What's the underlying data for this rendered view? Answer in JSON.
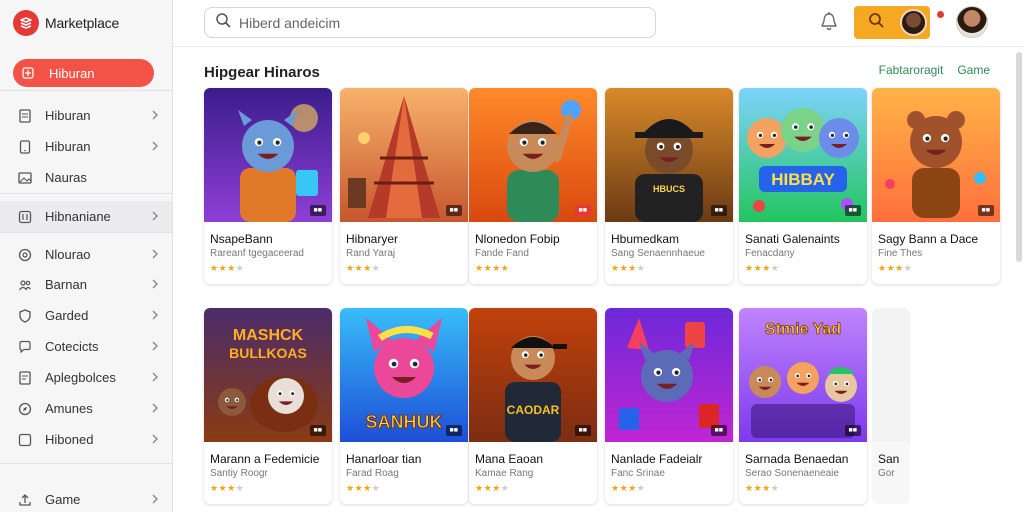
{
  "brand": {
    "name": "Marketplace",
    "icon": "layers-logo-icon"
  },
  "sidebar": {
    "active": {
      "label": "Hiburan",
      "icon": "play-grid-icon"
    },
    "items": [
      {
        "label": "Hiburan",
        "icon": "document-icon"
      },
      {
        "label": "Hiburan",
        "icon": "tablet-icon"
      },
      {
        "label": "Nauras",
        "icon": "image-icon"
      },
      {
        "label": "Hibnaniane",
        "icon": "sliders-icon"
      },
      {
        "label": "Nlourao",
        "icon": "target-icon"
      },
      {
        "label": "Barnan",
        "icon": "people-icon"
      },
      {
        "label": "Garded",
        "icon": "shield-icon"
      },
      {
        "label": "Cotecicts",
        "icon": "chat-icon"
      },
      {
        "label": "Aplegbolces",
        "icon": "doc-edit-icon"
      },
      {
        "label": "Amunes",
        "icon": "compass-icon"
      },
      {
        "label": "Hiboned",
        "icon": "square-icon"
      },
      {
        "label": "Game",
        "icon": "upload-icon"
      }
    ]
  },
  "topbar": {
    "search_placeholder": "Hiberd andeicim",
    "notification_icon": "bell-icon",
    "search_button_icon": "search-icon",
    "avatar_icon": "user-avatar"
  },
  "main": {
    "section_title": "Hipgear Hinaros",
    "links": [
      "Fabtaroragit",
      "Game"
    ],
    "cards": [
      {
        "title": "NsapeBann",
        "sub": "Rareanf tgegaceerad",
        "rating": 3,
        "tag": "",
        "art": "purple-hero"
      },
      {
        "title": "Hibnaryer",
        "sub": "Rand Yaraj",
        "rating": 3,
        "tag": "",
        "art": "tower"
      },
      {
        "title": "Nlonedon Fobip",
        "sub": "Fande Fand",
        "rating": 4,
        "tag": "",
        "art": "boy-ball"
      },
      {
        "title": "Hbumedkam",
        "sub": "Sang Senaennhaeue",
        "rating": 3,
        "tag": "",
        "art": "chef"
      },
      {
        "title": "Sanati Galenaints",
        "sub": "Fenacdany",
        "rating": 3,
        "tag": "",
        "art": "friends"
      },
      {
        "title": "Sagy Bann a Dace",
        "sub": "Fine Thes",
        "rating": 3,
        "tag": "",
        "art": "bear"
      },
      {
        "title": "Marann a Fedemicie",
        "sub": "Santiy Roogr",
        "rating": 3,
        "tag": "",
        "art": "bulldog"
      },
      {
        "title": "Hanarloar tian",
        "sub": "Farad Roag",
        "rating": 3,
        "tag": "",
        "art": "pink-cat"
      },
      {
        "title": "Mana Eaoan",
        "sub": "Kamae Rang",
        "rating": 3,
        "tag": "",
        "art": "kid-cap"
      },
      {
        "title": "Nanlade Fadeialr",
        "sub": "Fanc Srinae",
        "rating": 3,
        "tag": "",
        "art": "dog-party"
      },
      {
        "title": "Sarnada Benaedan",
        "sub": "Serao Sonenaeneaie",
        "rating": 3,
        "tag": "",
        "art": "squad"
      },
      {
        "title": "San",
        "sub": "Gor",
        "rating": 0,
        "tag": "",
        "art": "blank"
      }
    ]
  }
}
